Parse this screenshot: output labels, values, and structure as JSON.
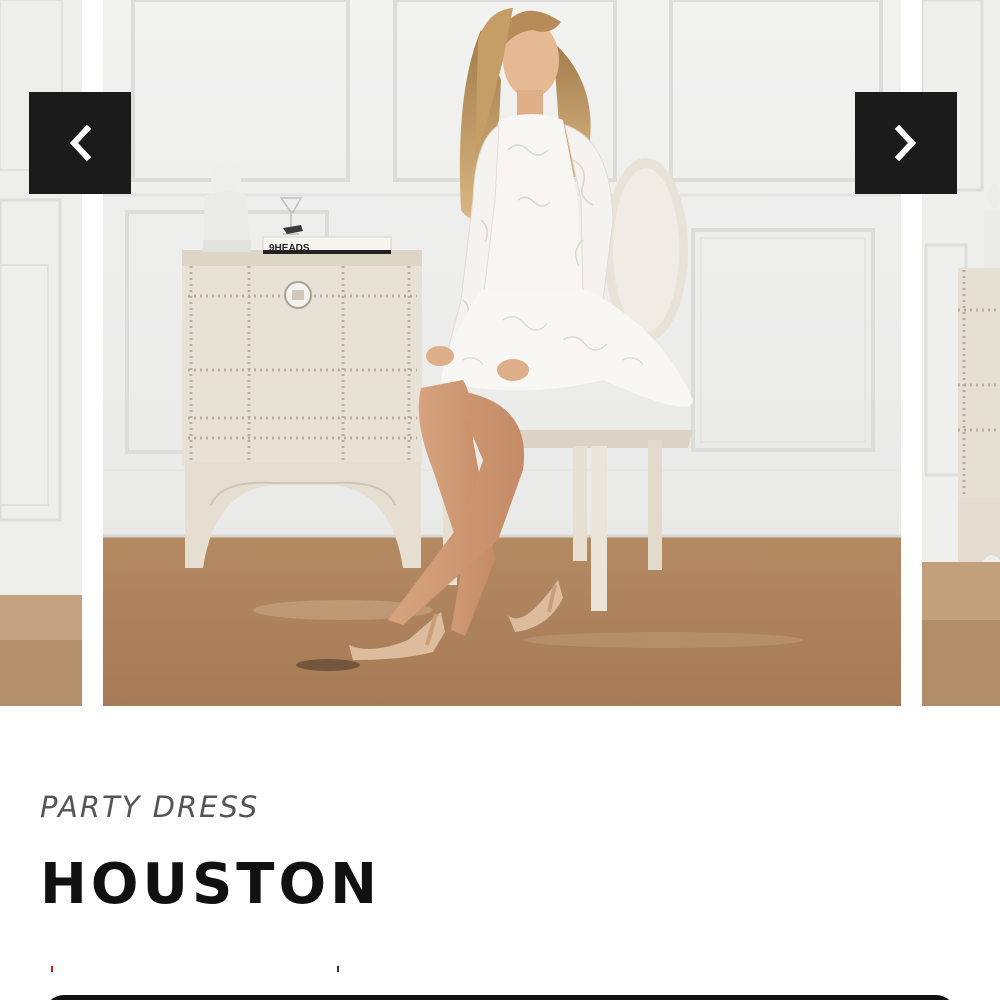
{
  "carousel": {
    "prev_label": "Previous image",
    "next_label": "Next image",
    "photo_alt": "Model wearing a white lace long-sleeve party dress, seated on a chair beside a studded side table",
    "book_text": "9HEADS"
  },
  "product": {
    "category": "PARTY DRESS",
    "name": "HOUSTON"
  },
  "icons": {
    "prev": "chevron-left-icon",
    "next": "chevron-right-icon"
  },
  "colors": {
    "nav_button_bg": "#1b1b1b",
    "nav_button_fg": "#ffffff",
    "title": "#111111",
    "category": "#555555",
    "accent_red": "#d21c1c"
  }
}
